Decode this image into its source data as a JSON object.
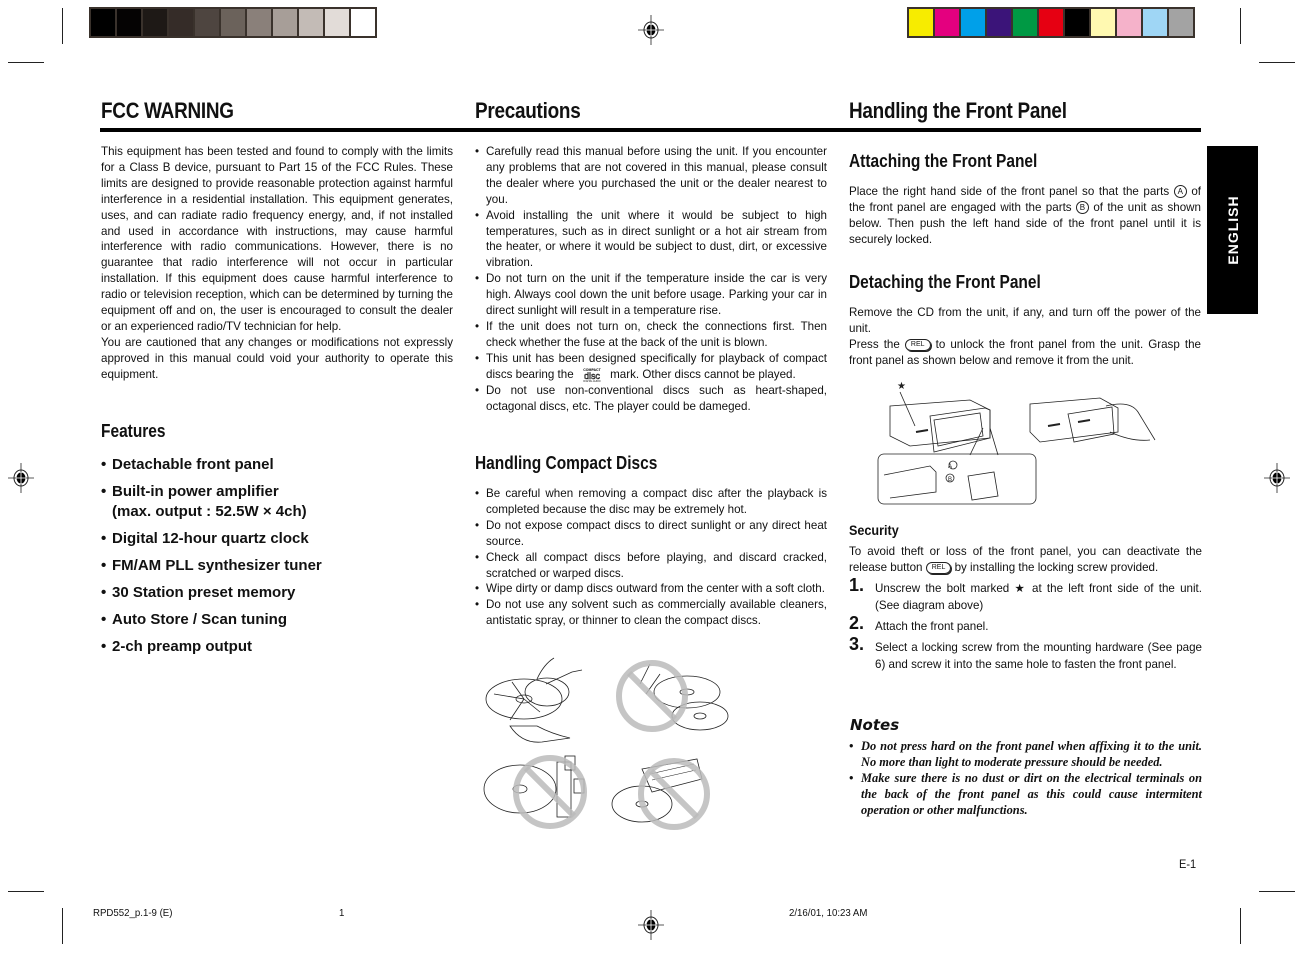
{
  "print_marks": {
    "grayscale_swatches": [
      "#000000",
      "#050303",
      "#1e1916",
      "#352c28",
      "#4e4540",
      "#6b625b",
      "#8a807a",
      "#a79e98",
      "#c3bbb6",
      "#e2dcd8",
      "#ffffff"
    ],
    "color_swatches": [
      "#f7ec00",
      "#e4007f",
      "#00a0e9",
      "#3b1479",
      "#009944",
      "#e60012",
      "#000000",
      "#fff9b1",
      "#f5b2ca",
      "#9fd6f5",
      "#a3a3a3"
    ]
  },
  "headings": {
    "fcc": "FCC WARNING",
    "precautions": "Precautions",
    "front_panel": "Handling the Front Panel"
  },
  "fcc": {
    "paragraph1": "This equipment has been tested and found to comply with the limits for a Class B device, pursuant to Part 15 of the FCC Rules. These limits are designed to provide reasonable protection against harmful interference in a residential installation. This equipment generates, uses, and can radiate radio frequency energy, and, if not installed and used in accordance with instructions, may cause harmful interference with radio communications. However, there is no guarantee that radio interference will not occur in particular installation. If this equipment does cause harmful interference to radio or television reception, which can be determined by turning the equipment off and on, the user is encouraged to consult the dealer or an experienced radio/TV technician for help.",
    "paragraph2": "You are cautioned that any changes or modifications not expressly approved in this manual could void your authority to operate this equipment."
  },
  "features": {
    "title": "Features",
    "items": [
      "Detachable front panel",
      "Built-in power amplifier",
      "(max. output : 52.5W × 4ch)",
      "Digital 12-hour quartz clock",
      "FM/AM PLL synthesizer tuner",
      "30 Station preset memory",
      "Auto Store / Scan tuning",
      "2-ch preamp output"
    ]
  },
  "precautions": {
    "items": [
      "Carefully read this manual before using the unit. If you encounter any problems that are not covered in this manual, please consult the dealer where you purchased the unit or the dealer nearest to you.",
      "Avoid installing the unit where it would be subject to high temperatures, such as in direct sunlight or a hot air stream from the heater, or where it would be subject to dust, dirt, or excessive vibration.",
      "Do not turn on the unit if the temperature inside the car is very high. Always cool down the unit before usage. Parking your car in direct sunlight will result in a temperature rise.",
      "If the unit does not turn on, check the connections first. Then check whether the fuse at the back of the unit is blown.",
      "Do not use non-conventional discs such as heart-shaped, octagonal discs, etc. The player could be dameged."
    ],
    "disc_item_before": "This unit has been designed specifically for playback of compact discs bearing the",
    "disc_item_after": "mark. Other discs cannot be played.",
    "disc_logo_text": "disc"
  },
  "compact_discs": {
    "title": "Handling Compact Discs",
    "items": [
      "Be careful when removing a compact disc after the playback is completed because the disc may be extremely hot.",
      "Do not expose compact discs to direct sunlight or any direct heat source.",
      "Check all compact discs before playing, and discard cracked, scratched or warped discs.",
      "Wipe dirty or damp discs outward from the center with a soft cloth.",
      "Do not use any solvent such as commercially available cleaners, antistatic spray, or thinner to clean the compact discs."
    ]
  },
  "attaching": {
    "title": "Attaching the Front Panel",
    "text_1": "Place the right hand side of the front panel so that the parts",
    "text_2": "of the front panel are engaged with the parts",
    "text_3": "of the unit as shown below. Then push the left hand side of the front panel until it is securely locked.",
    "part_a": "A",
    "part_b": "B"
  },
  "detaching": {
    "title": "Detaching the Front Panel",
    "text_1": "Remove the CD from the unit, if any, and turn off the power of the unit.",
    "text_2a": "Press the",
    "text_2b": "to unlock the front panel from the unit. Grasp the front panel as shown below and remove it from the unit.",
    "rel_label": "REL"
  },
  "diagram": {
    "star": "★",
    "label_a": "A",
    "label_b": "B"
  },
  "security": {
    "title": "Security",
    "text_a": "To avoid theft or loss of the front panel, you can deactivate the release button",
    "text_b": "by installing the locking screw provided.",
    "rel_label": "REL",
    "steps": [
      {
        "num": "1.",
        "text": "Unscrew the bolt marked ★ at the left front side of the unit. (See diagram above)"
      },
      {
        "num": "2.",
        "text": "Attach the front panel."
      },
      {
        "num": "3.",
        "text": "Select a locking screw from the mounting hardware (See page 6) and screw it into the same hole to fasten the front panel."
      }
    ]
  },
  "notes": {
    "title": "Notes",
    "items": [
      "Do not press hard on the front panel when affixing it to the unit. No more than light to moderate pressure should be needed.",
      "Make sure there is no dust or dirt on the electrical terminals on the back of the front panel as this could cause intermitent operation or other malfunctions."
    ]
  },
  "side_tab": "ENGLISH",
  "page_number": "E-1",
  "footer": {
    "file": "RPD552_p.1-9 (E)",
    "sheet": "1",
    "timestamp": "2/16/01, 10:23 AM"
  }
}
